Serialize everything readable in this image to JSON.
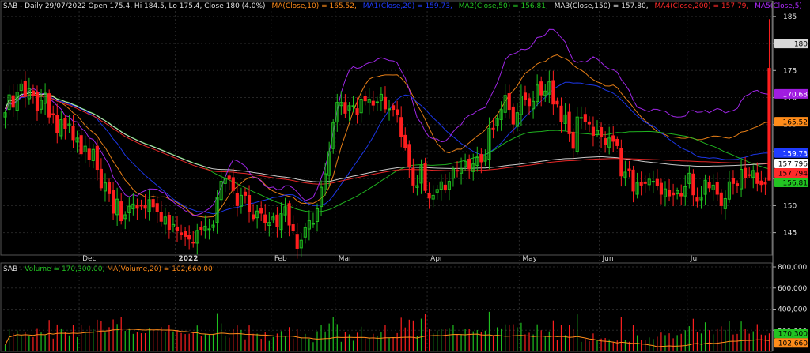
{
  "header": {
    "symbol_line": "SAB - Daily 29/07/2022 Open 175.4, Hi 184.5, Lo 175.4, Close 180 (4.0%)",
    "ma_labels": [
      {
        "text": "MA(Close,10) = 165.52,",
        "color": "#ff8c1a"
      },
      {
        "text": "MA1(Close,20) = 159.73,",
        "color": "#1f3cff"
      },
      {
        "text": "MA2(Close,50) = 156.81,",
        "color": "#22c422"
      },
      {
        "text": "MA3(Close,150) = 157.80,",
        "color": "#e0e0e0"
      },
      {
        "text": "MA4(Close,200) = 157.79,",
        "color": "#ff2a2a"
      },
      {
        "text": "MA5(Close,5) = 170.68",
        "color": "#b02aff"
      }
    ]
  },
  "volume_header": {
    "label": "SAB -",
    "volume_text": "Volume = 170,300.00,",
    "ma_text": "MA(Volume,20) = 102,660.00"
  },
  "chart_data": [
    {
      "type": "candlestick",
      "title": "SAB - Daily",
      "x_labels": [
        "Dec",
        "2022",
        "Feb",
        "Mar",
        "Apr",
        "May",
        "Jun",
        "Jul"
      ],
      "x_label_dates": [
        "2021-12-01",
        "2022-01-04",
        "2022-02-07",
        "2022-03-01",
        "2022-04-01",
        "2022-05-04",
        "2022-06-01",
        "2022-07-01"
      ],
      "ylim": [
        141,
        186
      ],
      "y_ticks": [
        145,
        150,
        155,
        160,
        165,
        170,
        175,
        180,
        185
      ],
      "grid": true,
      "colors": {
        "up": "#1fbf1f",
        "down": "#ff1f1f"
      },
      "close": [
        167.2,
        170.5,
        168.2,
        171.0,
        172.5,
        170.2,
        171.6,
        170.5,
        167.6,
        169.5,
        170.8,
        166.4,
        166.8,
        163.5,
        165.9,
        164.3,
        165.1,
        162.2,
        162.5,
        159.6,
        161.0,
        158.5,
        160.4,
        156.7,
        153.3,
        154.2,
        152.2,
        148.6,
        151.2,
        147.2,
        148.3,
        149.9,
        150.3,
        149.5,
        150.0,
        149.5,
        151.1,
        149.8,
        148.9,
        147.1,
        147.9,
        145.6,
        146.5,
        145.3,
        144.7,
        144.3,
        143.8,
        143.1,
        145.4,
        145.6,
        146.2,
        145.7,
        146.4,
        151.5,
        154.5,
        155.0,
        154.9,
        152.8,
        150.0,
        151.9,
        151.9,
        148.9,
        147.6,
        149.0,
        148.6,
        146.8,
        146.9,
        147.9,
        146.1,
        148.5,
        149.8,
        146.4,
        145.3,
        142.1,
        143.6,
        145.9,
        147.2,
        146.7,
        149.4,
        153.4,
        155.9,
        160.0,
        165.3,
        169.1,
        169.1,
        167.1,
        168.5,
        168.5,
        166.9,
        169.7,
        169.4,
        169.7,
        168.6,
        169.2,
        170.6,
        167.9,
        167.9,
        167.8,
        166.9,
        162.8,
        160.8,
        157.2,
        153.8,
        153.7,
        157.4,
        152.8,
        151.4,
        151.9,
        153.0,
        154.4,
        152.9,
        154.5,
        156.8,
        156.5,
        156.8,
        158.2,
        156.8,
        157.7,
        158.9,
        158.1,
        159.2,
        164.3,
        164.2,
        166.1,
        167.8,
        170.4,
        167.8,
        165.1,
        167.2,
        170.3,
        169.6,
        168.5,
        169.3,
        172.3,
        170.5,
        171.2,
        172.9,
        168.8,
        168.8,
        165.6,
        166.8,
        163.3,
        160.6,
        166.4,
        166.3,
        165.5,
        165.1,
        163.0,
        163.9,
        162.7,
        161.3,
        162.5,
        161.9,
        161.1,
        155.5,
        156.2,
        156.5,
        152.7,
        154.2,
        153.8,
        154.1,
        154.9,
        154.5,
        153.7,
        152.1,
        153.1,
        151.8,
        152.0,
        152.8,
        151.8,
        153.5,
        156.0,
        152.0,
        150.8,
        151.6,
        154.7,
        153.3,
        153.8,
        152.1,
        150.0,
        151.3,
        154.4,
        154.1,
        153.7,
        156.7,
        155.2,
        155.6,
        156.5,
        154.1,
        153.9,
        154.0,
        154.7,
        154.7,
        154.1,
        152.3,
        153.2,
        153.1,
        154.4,
        153.0,
        152.6,
        151.5,
        152.5,
        152.7,
        155.6,
        155.8,
        155.5,
        154.8,
        152.9,
        154.1,
        154.6,
        155.0,
        157.4,
        158.4,
        164.2,
        165.5,
        167.6,
        166.4,
        165.7,
        167.7,
        173.0,
        175.4,
        180.0
      ],
      "dates_start": "2021-11-04",
      "dates_end": "2022-07-29",
      "ma_lines": [
        {
          "name": "MA(Close,10)",
          "color": "#ff8c1a",
          "last": 165.52
        },
        {
          "name": "MA1(Close,20)",
          "color": "#1f3cff",
          "last": 159.73
        },
        {
          "name": "MA2(Close,50)",
          "color": "#22c422",
          "last": 156.81
        },
        {
          "name": "MA3(Close,150)",
          "color": "#e0e0e0",
          "last": 157.796
        },
        {
          "name": "MA4(Close,200)",
          "color": "#ff2a2a",
          "last": 157.794
        },
        {
          "name": "MA5(Close,5)",
          "color": "#b02aff",
          "last": 170.68
        }
      ],
      "last_price": {
        "open": 175.4,
        "high": 184.5,
        "low": 175.4,
        "close": 180
      }
    },
    {
      "type": "bar",
      "title": "Volume",
      "ylim": [
        0,
        800000
      ],
      "y_ticks": [
        200000,
        400000,
        600000,
        800000
      ],
      "y_tick_labels": [
        "200,000",
        "400,000",
        "600,000",
        "800,000"
      ],
      "last_volume": 170300,
      "volume_ma20": 102660,
      "ma_color": "#ff8c1a"
    }
  ],
  "axis_badges": [
    {
      "label": "180",
      "bg": "#d8d8d8",
      "fg": "#000000"
    },
    {
      "label": "170.68",
      "bg": "#a01ce0",
      "fg": "#ffffff"
    },
    {
      "label": "165.52",
      "bg": "#ff8c1a",
      "fg": "#000000"
    },
    {
      "label": "159.73",
      "bg": "#1f3cff",
      "fg": "#ffffff"
    },
    {
      "label": "157.796",
      "bg": "#ffffff",
      "fg": "#000000"
    },
    {
      "label": "157.794",
      "bg": "#ff2a2a",
      "fg": "#000000"
    },
    {
      "label": "156.81",
      "bg": "#22c422",
      "fg": "#000000"
    }
  ],
  "volume_badges": [
    {
      "label": "170,300",
      "bg": "#22c422",
      "fg": "#000000"
    },
    {
      "label": "102,660",
      "bg": "#ff8c1a",
      "fg": "#000000"
    }
  ]
}
